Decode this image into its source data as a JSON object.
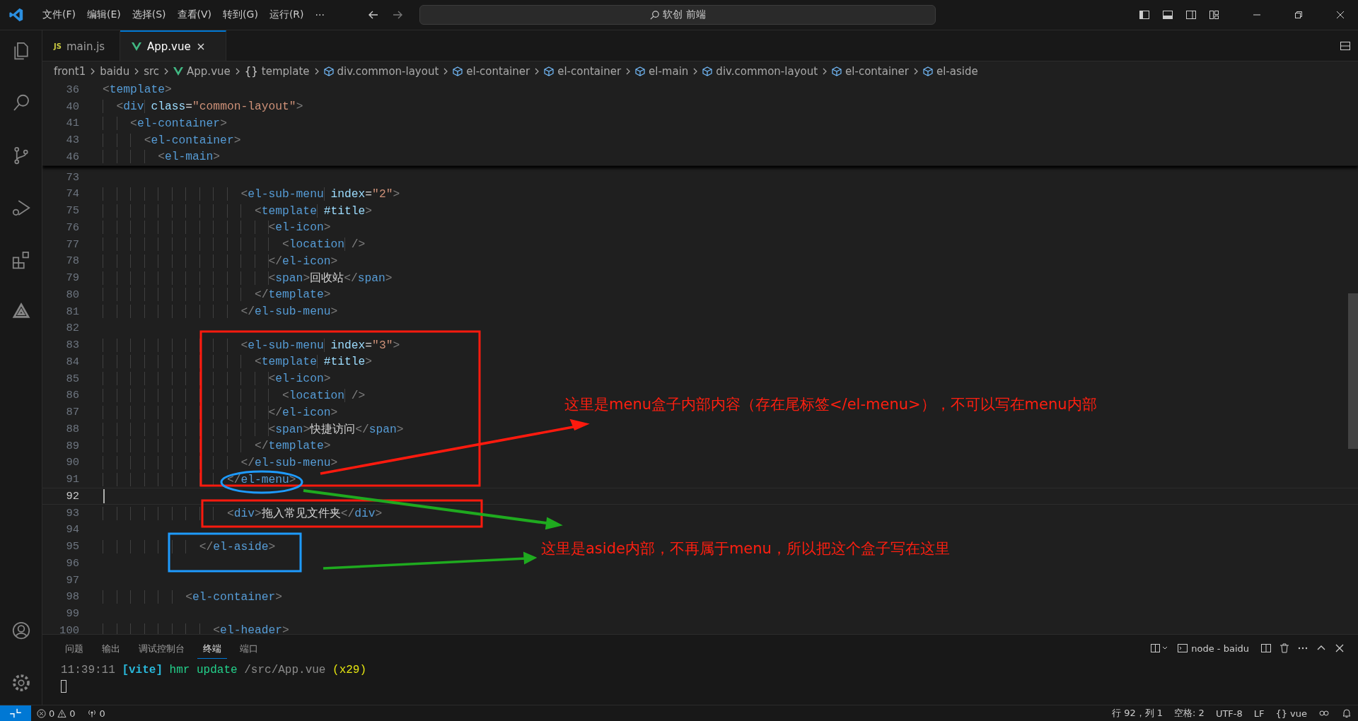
{
  "menu": [
    "文件(F)",
    "编辑(E)",
    "选择(S)",
    "查看(V)",
    "转到(G)",
    "运行(R)",
    "···"
  ],
  "search": {
    "value": "软创 前端"
  },
  "tabs": [
    {
      "label": "main.js",
      "kind": "js",
      "badge": "JS",
      "selected": false
    },
    {
      "label": "App.vue",
      "kind": "vue",
      "selected": true
    }
  ],
  "breadcrumb": [
    {
      "label": "front1",
      "kind": "folder"
    },
    {
      "label": "baidu",
      "kind": "folder"
    },
    {
      "label": "src",
      "kind": "folder"
    },
    {
      "label": "App.vue",
      "kind": "vue"
    },
    {
      "label": "template",
      "kind": "braces",
      "glyph": "{}"
    },
    {
      "label": "div.common-layout",
      "kind": "element"
    },
    {
      "label": "el-container",
      "kind": "element"
    },
    {
      "label": "el-container",
      "kind": "element"
    },
    {
      "label": "el-main",
      "kind": "element"
    },
    {
      "label": "div.common-layout",
      "kind": "element"
    },
    {
      "label": "el-container",
      "kind": "element"
    },
    {
      "label": "el-aside",
      "kind": "element"
    }
  ],
  "sticky_lines": [
    {
      "number": "36",
      "tokens": [
        {
          "kind": "punct",
          "text": "<"
        },
        {
          "kind": "tag",
          "text": "template"
        },
        {
          "kind": "punct",
          "text": ">"
        }
      ]
    },
    {
      "number": "40",
      "tokens": [
        {
          "kind": "punct",
          "text": "  <"
        },
        {
          "kind": "tag",
          "text": "div"
        },
        {
          "kind": "attr",
          "text": " class"
        },
        {
          "kind": "text",
          "text": "="
        },
        {
          "kind": "str",
          "text": "\"common-layout\""
        },
        {
          "kind": "punct",
          "text": ">"
        }
      ]
    },
    {
      "number": "41",
      "tokens": [
        {
          "kind": "punct",
          "text": "    <"
        },
        {
          "kind": "tag",
          "text": "el-container"
        },
        {
          "kind": "punct",
          "text": ">"
        }
      ]
    },
    {
      "number": "43",
      "tokens": [
        {
          "kind": "punct",
          "text": "      <"
        },
        {
          "kind": "tag",
          "text": "el-container"
        },
        {
          "kind": "punct",
          "text": ">"
        }
      ]
    },
    {
      "number": "46",
      "tokens": [
        {
          "kind": "punct",
          "text": "        <"
        },
        {
          "kind": "tag",
          "text": "el-main"
        },
        {
          "kind": "punct",
          "text": ">"
        }
      ]
    }
  ],
  "code_lines": [
    {
      "number": "73",
      "current": false
    },
    {
      "number": "74",
      "current": false,
      "tokens": [
        {
          "kind": "punct",
          "text": "                    <"
        },
        {
          "kind": "tag",
          "text": "el-sub-menu"
        },
        {
          "kind": "attr",
          "text": " index"
        },
        {
          "kind": "text",
          "text": "="
        },
        {
          "kind": "str",
          "text": "\"2\""
        },
        {
          "kind": "punct",
          "text": ">"
        }
      ]
    },
    {
      "number": "75",
      "current": false,
      "tokens": [
        {
          "kind": "punct",
          "text": "                      <"
        },
        {
          "kind": "tag",
          "text": "template"
        },
        {
          "kind": "attr",
          "text": " #title"
        },
        {
          "kind": "punct",
          "text": ">"
        }
      ]
    },
    {
      "number": "76",
      "current": false,
      "tokens": [
        {
          "kind": "punct",
          "text": "                        <"
        },
        {
          "kind": "tag",
          "text": "el-icon"
        },
        {
          "kind": "punct",
          "text": ">"
        }
      ]
    },
    {
      "number": "77",
      "current": false,
      "tokens": [
        {
          "kind": "punct",
          "text": "                          <"
        },
        {
          "kind": "tag",
          "text": "location"
        },
        {
          "kind": "punct",
          "text": " />"
        }
      ]
    },
    {
      "number": "78",
      "current": false,
      "tokens": [
        {
          "kind": "punct",
          "text": "                        </"
        },
        {
          "kind": "tag",
          "text": "el-icon"
        },
        {
          "kind": "punct",
          "text": ">"
        }
      ]
    },
    {
      "number": "79",
      "current": false,
      "tokens": [
        {
          "kind": "punct",
          "text": "                        <"
        },
        {
          "kind": "tag",
          "text": "span"
        },
        {
          "kind": "punct",
          "text": ">"
        },
        {
          "kind": "text",
          "text": "回收站"
        },
        {
          "kind": "punct",
          "text": "</"
        },
        {
          "kind": "tag",
          "text": "span"
        },
        {
          "kind": "punct",
          "text": ">"
        }
      ]
    },
    {
      "number": "80",
      "current": false,
      "tokens": [
        {
          "kind": "punct",
          "text": "                      </"
        },
        {
          "kind": "tag",
          "text": "template"
        },
        {
          "kind": "punct",
          "text": ">"
        }
      ]
    },
    {
      "number": "81",
      "current": false,
      "tokens": [
        {
          "kind": "punct",
          "text": "                    </"
        },
        {
          "kind": "tag",
          "text": "el-sub-menu"
        },
        {
          "kind": "punct",
          "text": ">"
        }
      ]
    },
    {
      "number": "82",
      "current": false
    },
    {
      "number": "83",
      "current": false,
      "tokens": [
        {
          "kind": "punct",
          "text": "                    <"
        },
        {
          "kind": "tag",
          "text": "el-sub-menu"
        },
        {
          "kind": "attr",
          "text": " index"
        },
        {
          "kind": "text",
          "text": "="
        },
        {
          "kind": "str",
          "text": "\"3\""
        },
        {
          "kind": "punct",
          "text": ">"
        }
      ]
    },
    {
      "number": "84",
      "current": false,
      "tokens": [
        {
          "kind": "punct",
          "text": "                      <"
        },
        {
          "kind": "tag",
          "text": "template"
        },
        {
          "kind": "attr",
          "text": " #title"
        },
        {
          "kind": "punct",
          "text": ">"
        }
      ]
    },
    {
      "number": "85",
      "current": false,
      "tokens": [
        {
          "kind": "punct",
          "text": "                        <"
        },
        {
          "kind": "tag",
          "text": "el-icon"
        },
        {
          "kind": "punct",
          "text": ">"
        }
      ]
    },
    {
      "number": "86",
      "current": false,
      "tokens": [
        {
          "kind": "punct",
          "text": "                          <"
        },
        {
          "kind": "tag",
          "text": "location"
        },
        {
          "kind": "punct",
          "text": " />"
        }
      ]
    },
    {
      "number": "87",
      "current": false,
      "tokens": [
        {
          "kind": "punct",
          "text": "                        </"
        },
        {
          "kind": "tag",
          "text": "el-icon"
        },
        {
          "kind": "punct",
          "text": ">"
        }
      ]
    },
    {
      "number": "88",
      "current": false,
      "tokens": [
        {
          "kind": "punct",
          "text": "                        <"
        },
        {
          "kind": "tag",
          "text": "span"
        },
        {
          "kind": "punct",
          "text": ">"
        },
        {
          "kind": "text",
          "text": "快捷访问"
        },
        {
          "kind": "punct",
          "text": "</"
        },
        {
          "kind": "tag",
          "text": "span"
        },
        {
          "kind": "punct",
          "text": ">"
        }
      ]
    },
    {
      "number": "89",
      "current": false,
      "tokens": [
        {
          "kind": "punct",
          "text": "                      </"
        },
        {
          "kind": "tag",
          "text": "template"
        },
        {
          "kind": "punct",
          "text": ">"
        }
      ]
    },
    {
      "number": "90",
      "current": false,
      "tokens": [
        {
          "kind": "punct",
          "text": "                    </"
        },
        {
          "kind": "tag",
          "text": "el-sub-menu"
        },
        {
          "kind": "punct",
          "text": ">"
        }
      ]
    },
    {
      "number": "91",
      "current": false,
      "tokens": [
        {
          "kind": "punct",
          "text": "                  </"
        },
        {
          "kind": "tag",
          "text": "el-menu"
        },
        {
          "kind": "punct",
          "text": ">"
        }
      ]
    },
    {
      "number": "92",
      "current": true
    },
    {
      "number": "93",
      "current": false,
      "tokens": [
        {
          "kind": "punct",
          "text": "                  <"
        },
        {
          "kind": "tag",
          "text": "div"
        },
        {
          "kind": "punct",
          "text": ">"
        },
        {
          "kind": "text",
          "text": "拖入常见文件夹"
        },
        {
          "kind": "punct",
          "text": "</"
        },
        {
          "kind": "tag",
          "text": "div"
        },
        {
          "kind": "punct",
          "text": ">"
        }
      ]
    },
    {
      "number": "94",
      "current": false
    },
    {
      "number": "95",
      "current": false,
      "tokens": [
        {
          "kind": "punct",
          "text": "              </"
        },
        {
          "kind": "tag",
          "text": "el-aside"
        },
        {
          "kind": "punct",
          "text": ">"
        }
      ]
    },
    {
      "number": "96",
      "current": false
    },
    {
      "number": "97",
      "current": false
    },
    {
      "number": "98",
      "current": false,
      "tokens": [
        {
          "kind": "punct",
          "text": "            <"
        },
        {
          "kind": "tag",
          "text": "el-container"
        },
        {
          "kind": "punct",
          "text": ">"
        }
      ]
    },
    {
      "number": "99",
      "current": false
    },
    {
      "number": "100",
      "current": false,
      "tokens": [
        {
          "kind": "punct",
          "text": "                <"
        },
        {
          "kind": "tag",
          "text": "el-header"
        },
        {
          "kind": "punct",
          "text": ">"
        }
      ]
    }
  ],
  "notes": [
    {
      "text": "这里是menu盒子内部内容（存在尾标签</el-menu>），不可以写在menu内部"
    },
    {
      "text": "这里是aside内部，不再属于menu，所以把这个盒子写在这里"
    }
  ],
  "panel": {
    "tabs": [
      {
        "label": "问题",
        "selected": false
      },
      {
        "label": "输出",
        "selected": false
      },
      {
        "label": "调试控制台",
        "selected": false
      },
      {
        "label": "终端",
        "selected": true
      },
      {
        "label": "端口",
        "selected": false
      }
    ],
    "terminal_name": "node - baidu",
    "terminal_line": [
      {
        "kind": "time",
        "text": "11:39:11"
      },
      {
        "kind": "vite",
        "text": "[vite]"
      },
      {
        "kind": "ok",
        "text": "hmr update"
      },
      {
        "kind": "path",
        "text": "/src/App.vue"
      },
      {
        "kind": "count",
        "text": "(x29)"
      }
    ]
  },
  "status_bar": {
    "errors": "0",
    "warnings": "0",
    "ports": "0",
    "position": "行 92，列 1",
    "spaces": "空格: 2",
    "encoding": "UTF-8",
    "eol": "LF",
    "language_glyph": "{}",
    "language": "vue"
  }
}
